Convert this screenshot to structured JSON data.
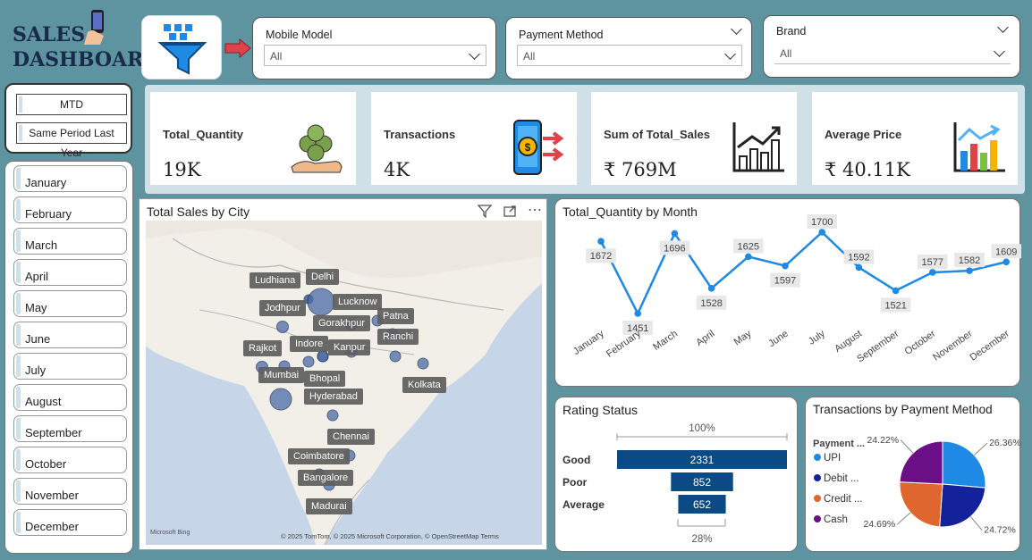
{
  "header": {
    "title_line1": "SALES",
    "title_line2": "DASHBOARD"
  },
  "filters": {
    "mobile_model": {
      "label": "Mobile Model",
      "value": "All"
    },
    "payment_method": {
      "label": "Payment Method",
      "value": "All"
    },
    "brand": {
      "label": "Brand",
      "value": "All"
    }
  },
  "period": {
    "mtd": "MTD",
    "same_period": "Same Period Last Year"
  },
  "months": [
    "January",
    "February",
    "March",
    "April",
    "May",
    "June",
    "July",
    "August",
    "September",
    "October",
    "November",
    "December"
  ],
  "kpis": [
    {
      "title": "Total_Quantity",
      "value": "19K",
      "icon": "money-bags-icon"
    },
    {
      "title": "Transactions",
      "value": "4K",
      "icon": "mobile-payment-icon"
    },
    {
      "title": "Sum of Total_Sales",
      "value": "₹ 769M",
      "icon": "growth-chart-icon"
    },
    {
      "title": "Average Price",
      "value": "₹ 40.11K",
      "icon": "bar-chart-icon"
    }
  ],
  "map": {
    "title": "Total Sales by City",
    "cities": [
      "Ludhiana",
      "Delhi",
      "Lucknow",
      "Jodhpur",
      "Gorakhpur",
      "Patna",
      "Ranchi",
      "Rajkot",
      "Indore",
      "Kanpur",
      "Mumbai",
      "Bhopal",
      "Hyderabad",
      "Kolkata",
      "Chennai",
      "Coimbatore",
      "Bangalore",
      "Madurai"
    ],
    "attribution": "© 2025 TomTom, © 2025 Microsoft Corporation, © OpenStreetMap  Terms",
    "bing": "Microsoft Bing"
  },
  "chart_data": [
    {
      "type": "line",
      "title": "Total_Quantity by Month",
      "categories": [
        "January",
        "February",
        "March",
        "April",
        "May",
        "June",
        "July",
        "August",
        "September",
        "October",
        "November",
        "December"
      ],
      "values": [
        1672,
        1451,
        1696,
        1528,
        1625,
        1597,
        1700,
        1592,
        1521,
        1577,
        1582,
        1609
      ],
      "color": "#1f8ae6"
    },
    {
      "type": "bar",
      "title": "Rating Status",
      "categories": [
        "Good",
        "Poor",
        "Average"
      ],
      "values": [
        2331,
        852,
        652
      ],
      "top_label": "100%",
      "bottom_label": "28%",
      "color": "#0b4a84"
    },
    {
      "type": "pie",
      "title": "Transactions by Payment Method",
      "legend_title": "Payment ...",
      "categories": [
        "UPI",
        "Debit ...",
        "Credit ...",
        "Cash"
      ],
      "values": [
        26.36,
        24.72,
        24.69,
        24.22
      ],
      "labels": [
        "26.36%",
        "24.72%",
        "24.69%",
        "24.22%"
      ],
      "colors": [
        "#1f8ae6",
        "#13229a",
        "#e0662f",
        "#6a0f86"
      ]
    }
  ]
}
